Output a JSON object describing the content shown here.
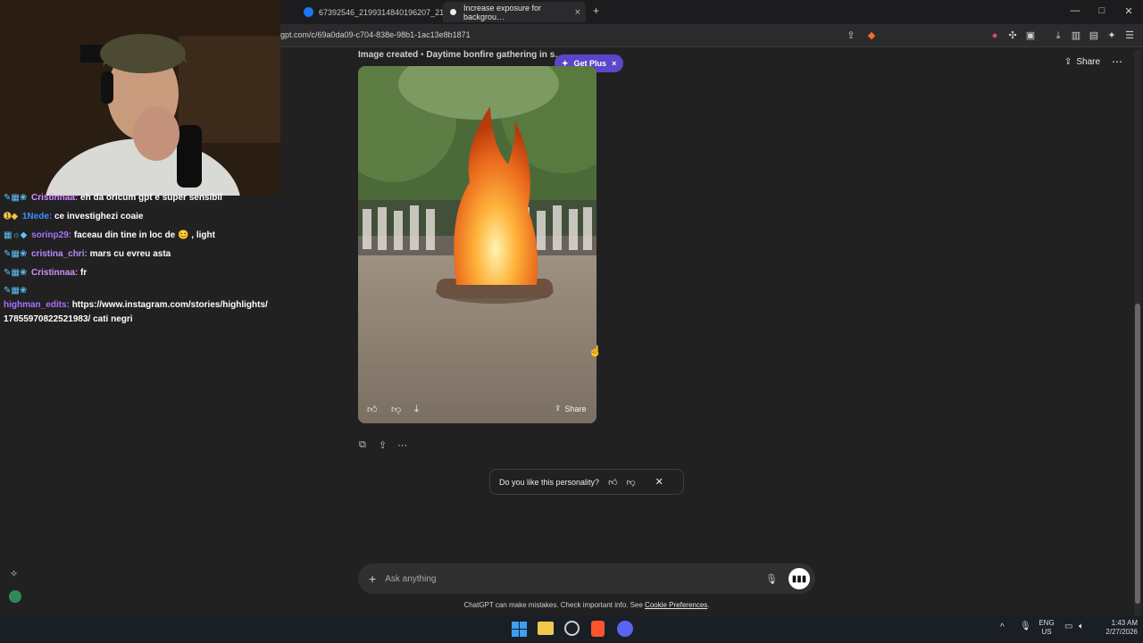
{
  "browser": {
    "tabs": [
      {
        "title": "67392546_2199314840196207_2134…",
        "active": false
      },
      {
        "title": "Increase exposure for backgrou…",
        "active": true
      }
    ],
    "new_tab_label": "+",
    "url": "gpt.com/c/69a0da09-c704-838e-98b1-1ac13e8b1871",
    "window_controls": [
      "—",
      "□",
      "✕"
    ]
  },
  "chat": {
    "messages": [
      {
        "user": "Cristinnaa",
        "text": "eh da oricum gpt e super sensibil",
        "color": "#d68cff"
      },
      {
        "user": "1Nede",
        "text": "ce investighezi coaie",
        "color": "#3d8bff"
      },
      {
        "user": "sorinp29",
        "text": "faceau din tine in loc de",
        "emote_text": ", light",
        "color": "#a970ff"
      },
      {
        "user": "cristina_chri",
        "text": "mars cu evreu asta",
        "color": "#b68cff"
      },
      {
        "user": "Cristinnaa",
        "text": "fr",
        "color": "#d68cff"
      },
      {
        "user": "highman_edits",
        "text": "https://www.instagram.com/stories/highlights/",
        "text2": "17855970822521983/ cati negri",
        "color": "#a970ff"
      }
    ]
  },
  "conversation": {
    "caption_status": "Image created",
    "caption_sep": "•",
    "caption_title": "Daytime bonfire gathering in s…",
    "get_plus": "Get Plus",
    "get_plus_close": "×",
    "share_label": "Share",
    "more_icon": "⋯",
    "image_share_label": "Share",
    "feedback_prompt": "Do you like this personality?",
    "composer_placeholder": "Ask anything",
    "disclaimer_text": "ChatGPT can make mistakes. Check important info. See ",
    "disclaimer_link": "Cookie Preferences",
    "disclaimer_end": "."
  },
  "taskbar": {
    "lang_line1": "ENG",
    "lang_line2": "US",
    "time": "1:43 AM",
    "date": "2/27/2026"
  },
  "colors": {
    "bg": "#212121",
    "get_plus": "#5a47c9",
    "composer": "#303030"
  }
}
